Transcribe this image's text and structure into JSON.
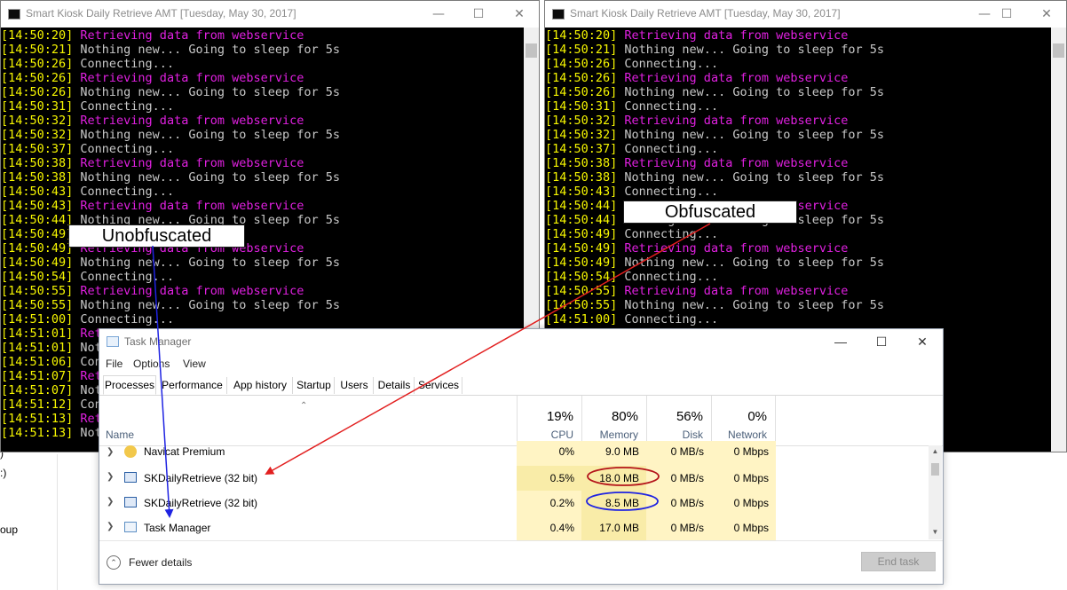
{
  "background": {
    "fragments": [
      ")",
      ":)",
      "oup"
    ]
  },
  "console_left": {
    "title": "Smart Kiosk Daily Retrieve AMT [Tuesday, May 30, 2017]",
    "lines": [
      {
        "ts": "[14:50:20]",
        "msg": "Retrieving data from webservice",
        "kind": "m"
      },
      {
        "ts": "[14:50:21]",
        "msg": "Nothing new... Going to sleep for 5s",
        "kind": "n"
      },
      {
        "ts": "[14:50:26]",
        "msg": "Connecting...",
        "kind": "c"
      },
      {
        "ts": "[14:50:26]",
        "msg": "Retrieving data from webservice",
        "kind": "m"
      },
      {
        "ts": "[14:50:26]",
        "msg": "Nothing new... Going to sleep for 5s",
        "kind": "n"
      },
      {
        "ts": "[14:50:31]",
        "msg": "Connecting...",
        "kind": "c"
      },
      {
        "ts": "[14:50:32]",
        "msg": "Retrieving data from webservice",
        "kind": "m"
      },
      {
        "ts": "[14:50:32]",
        "msg": "Nothing new... Going to sleep for 5s",
        "kind": "n"
      },
      {
        "ts": "[14:50:37]",
        "msg": "Connecting...",
        "kind": "c"
      },
      {
        "ts": "[14:50:38]",
        "msg": "Retrieving data from webservice",
        "kind": "m"
      },
      {
        "ts": "[14:50:38]",
        "msg": "Nothing new... Going to sleep for 5s",
        "kind": "n"
      },
      {
        "ts": "[14:50:43]",
        "msg": "Connecting...",
        "kind": "c"
      },
      {
        "ts": "[14:50:43]",
        "msg": "Retrieving data from webservice",
        "kind": "m"
      },
      {
        "ts": "[14:50:44]",
        "msg": "Nothing new... Going to sleep for 5s",
        "kind": "n"
      },
      {
        "ts": "[14:50:49]",
        "msg": "Connecting...",
        "kind": "c"
      },
      {
        "ts": "[14:50:49]",
        "msg": "Retrieving data from webservice",
        "kind": "m"
      },
      {
        "ts": "[14:50:49]",
        "msg": "Nothing new... Going to sleep for 5s",
        "kind": "n"
      },
      {
        "ts": "[14:50:54]",
        "msg": "Connecting...",
        "kind": "c"
      },
      {
        "ts": "[14:50:55]",
        "msg": "Retrieving data from webservice",
        "kind": "m"
      },
      {
        "ts": "[14:50:55]",
        "msg": "Nothing new... Going to sleep for 5s",
        "kind": "n"
      },
      {
        "ts": "[14:51:00]",
        "msg": "Connecting...",
        "kind": "c"
      },
      {
        "ts": "[14:51:01]",
        "msg": "Retrieving data from webservice",
        "kind": "m"
      },
      {
        "ts": "[14:51:01]",
        "msg": "Nothing new... Going to sleep for 5s",
        "kind": "n"
      },
      {
        "ts": "[14:51:06]",
        "msg": "Connecting...",
        "kind": "c"
      },
      {
        "ts": "[14:51:07]",
        "msg": "Retrieving data from webservice",
        "kind": "m"
      },
      {
        "ts": "[14:51:07]",
        "msg": "Nothing new... Going to sleep for 5s",
        "kind": "n"
      },
      {
        "ts": "[14:51:12]",
        "msg": "Connecting...",
        "kind": "c"
      },
      {
        "ts": "[14:51:13]",
        "msg": "Retrieving data from webservice",
        "kind": "m"
      },
      {
        "ts": "[14:51:13]",
        "msg": "Nothing new... Going to sleep for 5s",
        "kind": "n"
      }
    ]
  },
  "console_right": {
    "title": "Smart Kiosk Daily Retrieve AMT [Tuesday, May 30, 2017]",
    "lines": [
      {
        "ts": "[14:50:20]",
        "msg": "Retrieving data from webservice",
        "kind": "m"
      },
      {
        "ts": "[14:50:21]",
        "msg": "Nothing new... Going to sleep for 5s",
        "kind": "n"
      },
      {
        "ts": "[14:50:26]",
        "msg": "Connecting...",
        "kind": "c"
      },
      {
        "ts": "[14:50:26]",
        "msg": "Retrieving data from webservice",
        "kind": "m"
      },
      {
        "ts": "[14:50:26]",
        "msg": "Nothing new... Going to sleep for 5s",
        "kind": "n"
      },
      {
        "ts": "[14:50:31]",
        "msg": "Connecting...",
        "kind": "c"
      },
      {
        "ts": "[14:50:32]",
        "msg": "Retrieving data from webservice",
        "kind": "m"
      },
      {
        "ts": "[14:50:32]",
        "msg": "Nothing new... Going to sleep for 5s",
        "kind": "n"
      },
      {
        "ts": "[14:50:37]",
        "msg": "Connecting...",
        "kind": "c"
      },
      {
        "ts": "[14:50:38]",
        "msg": "Retrieving data from webservice",
        "kind": "m"
      },
      {
        "ts": "[14:50:38]",
        "msg": "Nothing new... Going to sleep for 5s",
        "kind": "n"
      },
      {
        "ts": "[14:50:43]",
        "msg": "Connecting...",
        "kind": "c"
      },
      {
        "ts": "[14:50:44]",
        "msg": "Retrieving data from webservice",
        "kind": "m"
      },
      {
        "ts": "[14:50:44]",
        "msg": "Nothing new... Going to sleep for 5s",
        "kind": "n"
      },
      {
        "ts": "[14:50:49]",
        "msg": "Connecting...",
        "kind": "c"
      },
      {
        "ts": "[14:50:49]",
        "msg": "Retrieving data from webservice",
        "kind": "m"
      },
      {
        "ts": "[14:50:49]",
        "msg": "Nothing new... Going to sleep for 5s",
        "kind": "n"
      },
      {
        "ts": "[14:50:54]",
        "msg": "Connecting...",
        "kind": "c"
      },
      {
        "ts": "[14:50:55]",
        "msg": "Retrieving data from webservice",
        "kind": "m"
      },
      {
        "ts": "[14:50:55]",
        "msg": "Nothing new... Going to sleep for 5s",
        "kind": "n"
      },
      {
        "ts": "[14:51:00]",
        "msg": "Connecting...",
        "kind": "c"
      }
    ]
  },
  "annotations": {
    "unobfuscated": "Unobfuscated",
    "obfuscated": "Obfuscated",
    "red": "#e21f1f",
    "blue": "#1f23e2"
  },
  "task_manager": {
    "title": "Task Manager",
    "menu": [
      "File",
      "Options",
      "View"
    ],
    "tabs": [
      "Processes",
      "Performance",
      "App history",
      "Startup",
      "Users",
      "Details",
      "Services"
    ],
    "columns": {
      "name": "Name",
      "cpu": {
        "pct": "19%",
        "label": "CPU"
      },
      "memory": {
        "pct": "80%",
        "label": "Memory"
      },
      "disk": {
        "pct": "56%",
        "label": "Disk"
      },
      "network": {
        "pct": "0%",
        "label": "Network"
      }
    },
    "rows": [
      {
        "name": "Navicat Premium",
        "icon": "navicat-icon",
        "cpu": "0%",
        "memory": "9.0 MB",
        "disk": "0 MB/s",
        "network": "0 Mbps"
      },
      {
        "name": "SKDailyRetrieve (32 bit)",
        "icon": "console-app-icon",
        "cpu": "0.5%",
        "memory": "18.0 MB",
        "disk": "0 MB/s",
        "network": "0 Mbps"
      },
      {
        "name": "SKDailyRetrieve (32 bit)",
        "icon": "console-app-icon",
        "cpu": "0.2%",
        "memory": "8.5 MB",
        "disk": "0 MB/s",
        "network": "0 Mbps"
      },
      {
        "name": "Task Manager",
        "icon": "task-manager-icon",
        "cpu": "0.4%",
        "memory": "17.0 MB",
        "disk": "0 MB/s",
        "network": "0 Mbps"
      }
    ],
    "fewer_details": "Fewer details",
    "end_task": "End task"
  }
}
